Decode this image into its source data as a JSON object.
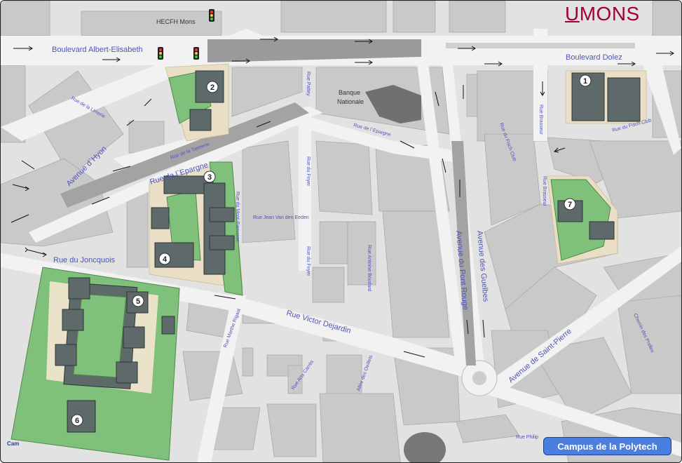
{
  "title_badge": "Campus de la Polytech",
  "logo": {
    "u": "U",
    "rest": "MONS"
  },
  "credit": "Cam",
  "streets": {
    "albert_elisabeth": "Boulevard Albert-Elisabeth",
    "dolez": "Boulevard Dolez",
    "limerie": "Rue de la Limerie",
    "hyon": "Avenue d`Hyon",
    "tannerie": "Rue de la Tannerie",
    "epargne_big": "Rue de l`Epargne",
    "epargne_small": "Rue de l`Epargne",
    "pattey": "Rue Pattey",
    "foyer_1": "Rue du Foyer",
    "foyer_2": "Rue du Foyer",
    "foyer_3": "Rue du Foyer",
    "fisch_club": "Rue du Fisch Club",
    "fisch_club_2": "Rue du Fisch Club",
    "brasseur_1": "Rue Brasseur",
    "brasseur_2": "Rue Brasseur",
    "mont_parnasse": "Rue du Mont-Parnasse",
    "jean_van_den_eeden": "Rue Jean Van den Eeden",
    "antoine_bourlard": "Rue Antoine Bourlard",
    "guelbes": "Avenue des Guelbes",
    "pont_rouge": "Avenue du Pont Rouge",
    "joncquois": "Rue du Joncquois",
    "victor_dejardin": "Rue Victor Dejardin",
    "marthe_rigaut": "Rue Marthe Rigaut",
    "arts_cartes": "Rue Arts Carrés",
    "allee_oeillets": "Allée des Oeillets",
    "saint_pierre": "Avenue de Saint-Pierre",
    "prelles": "Chemin des Prelles",
    "philippe": "Rue Philip"
  },
  "places": {
    "hecfh": "HECFH Mons",
    "banque_1": "Banque",
    "banque_2": "Nationale"
  },
  "buildings": [
    "1",
    "2",
    "3",
    "4",
    "5",
    "6",
    "7"
  ],
  "colors": {
    "badge": "#4a7fe0",
    "logo": "#a1003a",
    "street_label": "#4f55b8",
    "green": "#7fc07a",
    "building_dark": "#5e6a6a"
  }
}
